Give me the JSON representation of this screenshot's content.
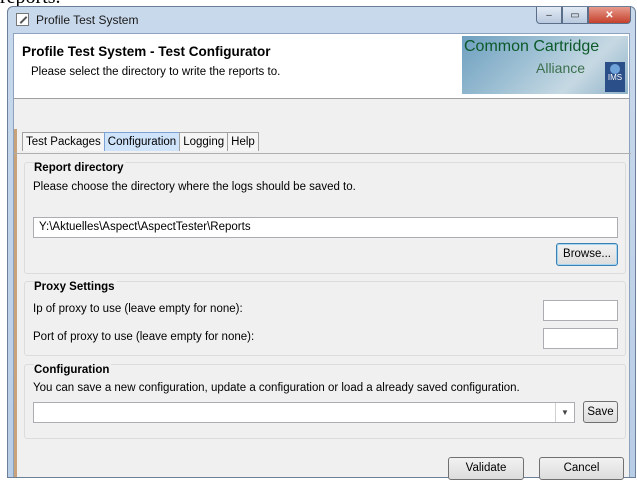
{
  "background_text": "reports.",
  "window": {
    "title": "Profile Test System",
    "buttons": {
      "minimize": "–",
      "maximize": "▭",
      "close": "✕"
    }
  },
  "header": {
    "title": "Profile Test System - Test Configurator",
    "subtitle": "Please select the directory to write the reports to.",
    "logo": {
      "line1": "Common Cartridge",
      "line2": "Alliance",
      "badge": "IMS"
    }
  },
  "tabs": [
    {
      "label": "Test Packages",
      "active": false
    },
    {
      "label": "Configuration",
      "active": true
    },
    {
      "label": "Logging",
      "active": false
    },
    {
      "label": "Help",
      "active": false
    }
  ],
  "report_directory": {
    "title": "Report directory",
    "description": "Please choose the directory where the logs should be saved to.",
    "path_value": "Y:\\Aktuelles\\Aspect\\AspectTester\\Reports",
    "browse_label": "Browse..."
  },
  "proxy_settings": {
    "title": "Proxy Settings",
    "ip_label": "Ip of proxy to use (leave empty for none):",
    "ip_value": "",
    "port_label": "Port of proxy to use (leave empty for none):",
    "port_value": ""
  },
  "configuration": {
    "title": "Configuration",
    "description": "You can save a new configuration, update a configuration or load a already saved configuration.",
    "combo_value": "",
    "save_label": "Save"
  },
  "footer": {
    "validate_label": "Validate",
    "cancel_label": "Cancel"
  },
  "colors": {
    "active_tab": "#cfe3fb",
    "close_button": "#c4402b",
    "title_bar": "#c9d9ec"
  }
}
